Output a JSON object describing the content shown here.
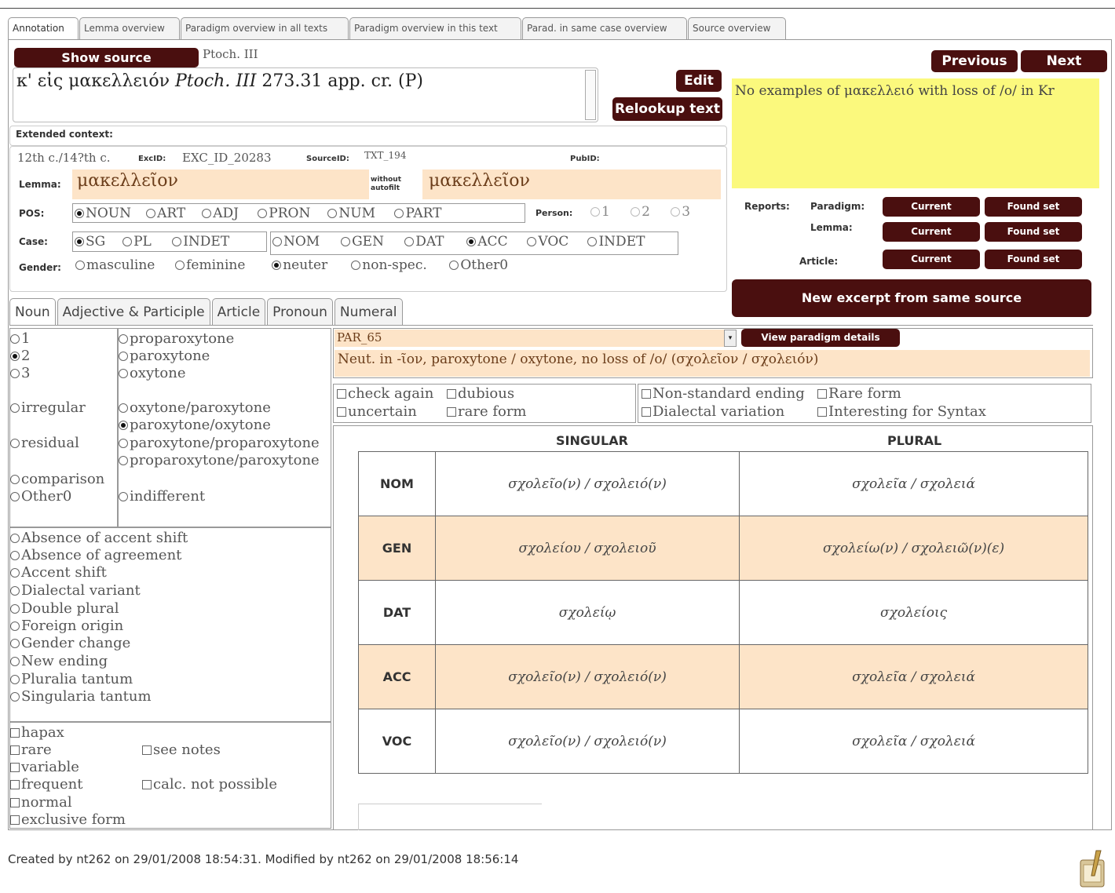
{
  "tabs": [
    "Annotation",
    "Lemma overview",
    "Paradigm overview in all texts",
    "Paradigm overview in this text",
    "Parad. in same case overview",
    "Source overview"
  ],
  "source": {
    "button": "Show source",
    "name": "Ptoch. III",
    "text_plain": "κ' εἰς μακελλειόν ",
    "text_italic": "Ptoch. III",
    "text_ref": " 273.31 app. cr. (P)",
    "edit": "Edit",
    "relookup": "Relookup text",
    "extended_label": "Extended context:"
  },
  "nav": {
    "previous": "Previous",
    "next": "Next"
  },
  "note": "No examples of μακελλειό with loss of /o/ in Kr",
  "meta": {
    "date": "12th c./14?th c.",
    "excid_label": "ExcID:",
    "excid": "EXC_ID_20283",
    "sourceid_label": "SourceID:",
    "sourceid": "TXT_194",
    "pubid_label": "PubID:"
  },
  "lemma": {
    "label": "Lemma:",
    "value": "μακελλεῖον",
    "without_label": "without autofilt",
    "without_value": "μακελλεῖον"
  },
  "pos": {
    "label": "POS:",
    "options": [
      "NOUN",
      "ART",
      "ADJ",
      "PRON",
      "NUM",
      "PART"
    ],
    "selected": "NOUN"
  },
  "person": {
    "label": "Person:",
    "options": [
      "1",
      "2",
      "3"
    ]
  },
  "number": {
    "label": "Case:",
    "options": [
      "SG",
      "PL",
      "INDET"
    ],
    "selected": "SG"
  },
  "case": {
    "options": [
      "NOM",
      "GEN",
      "DAT",
      "ACC",
      "VOC",
      "INDET"
    ],
    "selected": "ACC"
  },
  "gender": {
    "label": "Gender:",
    "options": [
      "masculine",
      "feminine",
      "neuter",
      "non-spec.",
      "Other0"
    ],
    "selected": "neuter"
  },
  "reports": {
    "label": "Reports:",
    "rows": [
      {
        "label": "Paradigm:"
      },
      {
        "label": "Lemma:"
      },
      {
        "label": "Article:"
      }
    ],
    "current": "Current",
    "found": "Found set"
  },
  "new_excerpt": "New excerpt from same source",
  "subtabs": [
    "Noun",
    "Adjective & Participle",
    "Article",
    "Pronoun",
    "Numeral"
  ],
  "decl": {
    "classes": [
      "1",
      "2",
      "3"
    ],
    "selected": "2",
    "irregular": "irregular",
    "residual": "residual",
    "comparison": "comparison",
    "other": "Other0"
  },
  "accent": {
    "basic": [
      "proparoxytone",
      "paroxytone",
      "oxytone"
    ],
    "shifts": [
      "oxytone/paroxytone",
      "paroxytone/oxytone",
      "paroxytone/proparoxytone",
      "proparoxytone/paroxytone"
    ],
    "selected": "paroxytone/oxytone",
    "indifferent": "indifferent"
  },
  "phenomena": [
    "Absence of accent shift",
    "Absence of agreement",
    "Accent shift",
    "Dialectal variant",
    "Double plural",
    "Foreign origin",
    "Gender change",
    "New ending",
    "Pluralia tantum",
    "Singularia tantum"
  ],
  "freq": [
    "hapax",
    "rare",
    "variable",
    "frequent",
    "normal",
    "exclusive form"
  ],
  "freq_side": [
    "see notes",
    "calc. not possible"
  ],
  "paradigm": {
    "code": "PAR_65",
    "view": "View paradigm details",
    "desc": "Neut. in -ῖον, paroxytone / oxytone, no loss of /o/ (σχολεῖον / σχολειόν)"
  },
  "flags_left": [
    "check again",
    "dubious",
    "uncertain",
    "rare form"
  ],
  "flags_right": [
    "Non-standard ending",
    "Rare form",
    "Dialectal variation",
    "Interesting for Syntax"
  ],
  "table": {
    "sg": "SINGULAR",
    "pl": "PLURAL",
    "rows": [
      {
        "case": "NOM",
        "sg": "σχολεῖο(ν) / σχολειό(ν)",
        "pl": "σχολεῖα / σχολειά"
      },
      {
        "case": "GEN",
        "sg": "σχολείου / σχολειοῦ",
        "pl": "σχολείω(ν) / σχολειῶ(ν)(ε)"
      },
      {
        "case": "DAT",
        "sg": "σχολείῳ",
        "pl": "σχολείοις"
      },
      {
        "case": "ACC",
        "sg": "σχολεῖο(ν) / σχολειό(ν)",
        "pl": "σχολεῖα / σχολειά"
      },
      {
        "case": "VOC",
        "sg": "σχολεῖο(ν) / σχολειό(ν)",
        "pl": "σχολεῖα / σχολειά"
      }
    ]
  },
  "footer": "Created by nt262 on 29/01/2008 18:54:31. Modified by nt262 on 29/01/2008 18:56:14"
}
